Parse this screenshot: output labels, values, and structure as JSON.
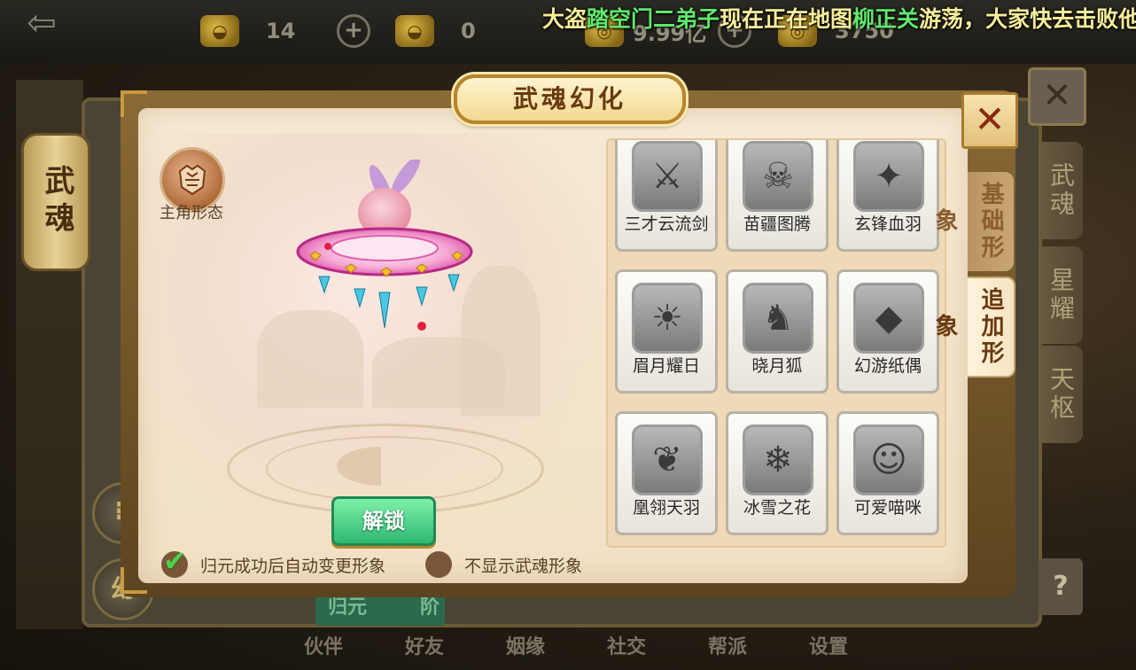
{
  "top_bar": {
    "resources": [
      {
        "icon": "gold-ingot-icon",
        "value": "14",
        "has_plus": true
      },
      {
        "icon": "locked-gold-ingot-icon",
        "value": "0",
        "has_plus": false
      },
      {
        "icon": "coin-stack-icon",
        "value": "9.99亿",
        "has_plus": true
      },
      {
        "icon": "locked-coin-icon",
        "value": "3750",
        "has_plus": false
      }
    ],
    "marquee": {
      "part1": "大盗",
      "name": "踏空门二弟子",
      "part2": "现在正在地图",
      "map": "柳正关",
      "part3": "游荡，大家快去击败他"
    }
  },
  "background_ui": {
    "lantern_text": "武魂",
    "left_round_buttons": [
      "",
      "幻"
    ],
    "right_tabs": [
      "武魂",
      "星耀",
      "天枢"
    ],
    "help": "?",
    "green_button": "归元",
    "green_button_suffix": "阶",
    "bottom_nav": [
      "伙伴",
      "好友",
      "姻缘",
      "社交",
      "帮派",
      "设置"
    ]
  },
  "dialog": {
    "title": "武魂幻化",
    "role_label": "主角形态",
    "unlock_button": "解锁",
    "option_auto_change": {
      "label": "归元成功后自动变更形象",
      "checked": true
    },
    "option_hide": {
      "label": "不显示武魂形象",
      "checked": false
    },
    "side_tabs": [
      {
        "label": "基础形象",
        "active": false
      },
      {
        "label": "追加形象",
        "active": true
      }
    ],
    "forms": [
      {
        "name": "三才云流剑",
        "icon": "crossed-swords-icon",
        "glyph": "⚔"
      },
      {
        "name": "苗疆图腾",
        "icon": "totem-mask-icon",
        "glyph": "☠"
      },
      {
        "name": "玄锋血羽",
        "icon": "feather-wing-icon",
        "glyph": "✦"
      },
      {
        "name": "眉月耀日",
        "icon": "sun-moon-icon",
        "glyph": "☀"
      },
      {
        "name": "晓月狐",
        "icon": "fox-icon",
        "glyph": "♞"
      },
      {
        "name": "幻游纸偶",
        "icon": "paper-puppet-icon",
        "glyph": "◆"
      },
      {
        "name": "凰翎天羽",
        "icon": "phoenix-icon",
        "glyph": "❦"
      },
      {
        "name": "冰雪之花",
        "icon": "snowflake-icon",
        "glyph": "❄"
      },
      {
        "name": "可爱喵咪",
        "icon": "cat-icon",
        "glyph": "☺"
      }
    ]
  },
  "colors": {
    "dialog_bg": "#f4e4ca",
    "marquee_yellow": "#f6ee9a",
    "marquee_green": "#5fe86c",
    "unlock_green": "#2fb870",
    "frame_gold": "#b8852a"
  }
}
